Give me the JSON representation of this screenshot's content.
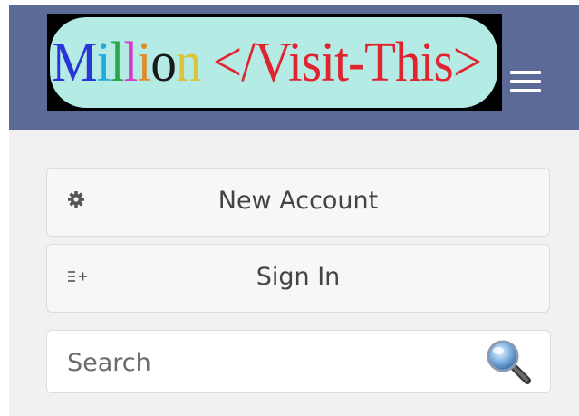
{
  "header": {
    "logo": {
      "segments": [
        {
          "text": "M",
          "color": "#2a35d8"
        },
        {
          "text": "i",
          "color": "#22a9e0"
        },
        {
          "text": "l",
          "color": "#2aa84a"
        },
        {
          "text": "l",
          "color": "#d23cc9"
        },
        {
          "text": "i",
          "color": "#e08a2a"
        },
        {
          "text": "o",
          "color": "#1a1a1a"
        },
        {
          "text": "n",
          "color": "#d9c43a"
        },
        {
          "text": " </Visit-This>",
          "color": "#e0232f"
        }
      ]
    },
    "menu_icon": "hamburger-icon",
    "background_color": "#5b6a96"
  },
  "actions": {
    "new_account": {
      "label": "New Account",
      "icon": "gear-icon"
    },
    "sign_in": {
      "label": "Sign In",
      "icon": "list-add-icon"
    }
  },
  "search": {
    "placeholder": "Search",
    "value": "",
    "icon": "magnifier-icon"
  }
}
